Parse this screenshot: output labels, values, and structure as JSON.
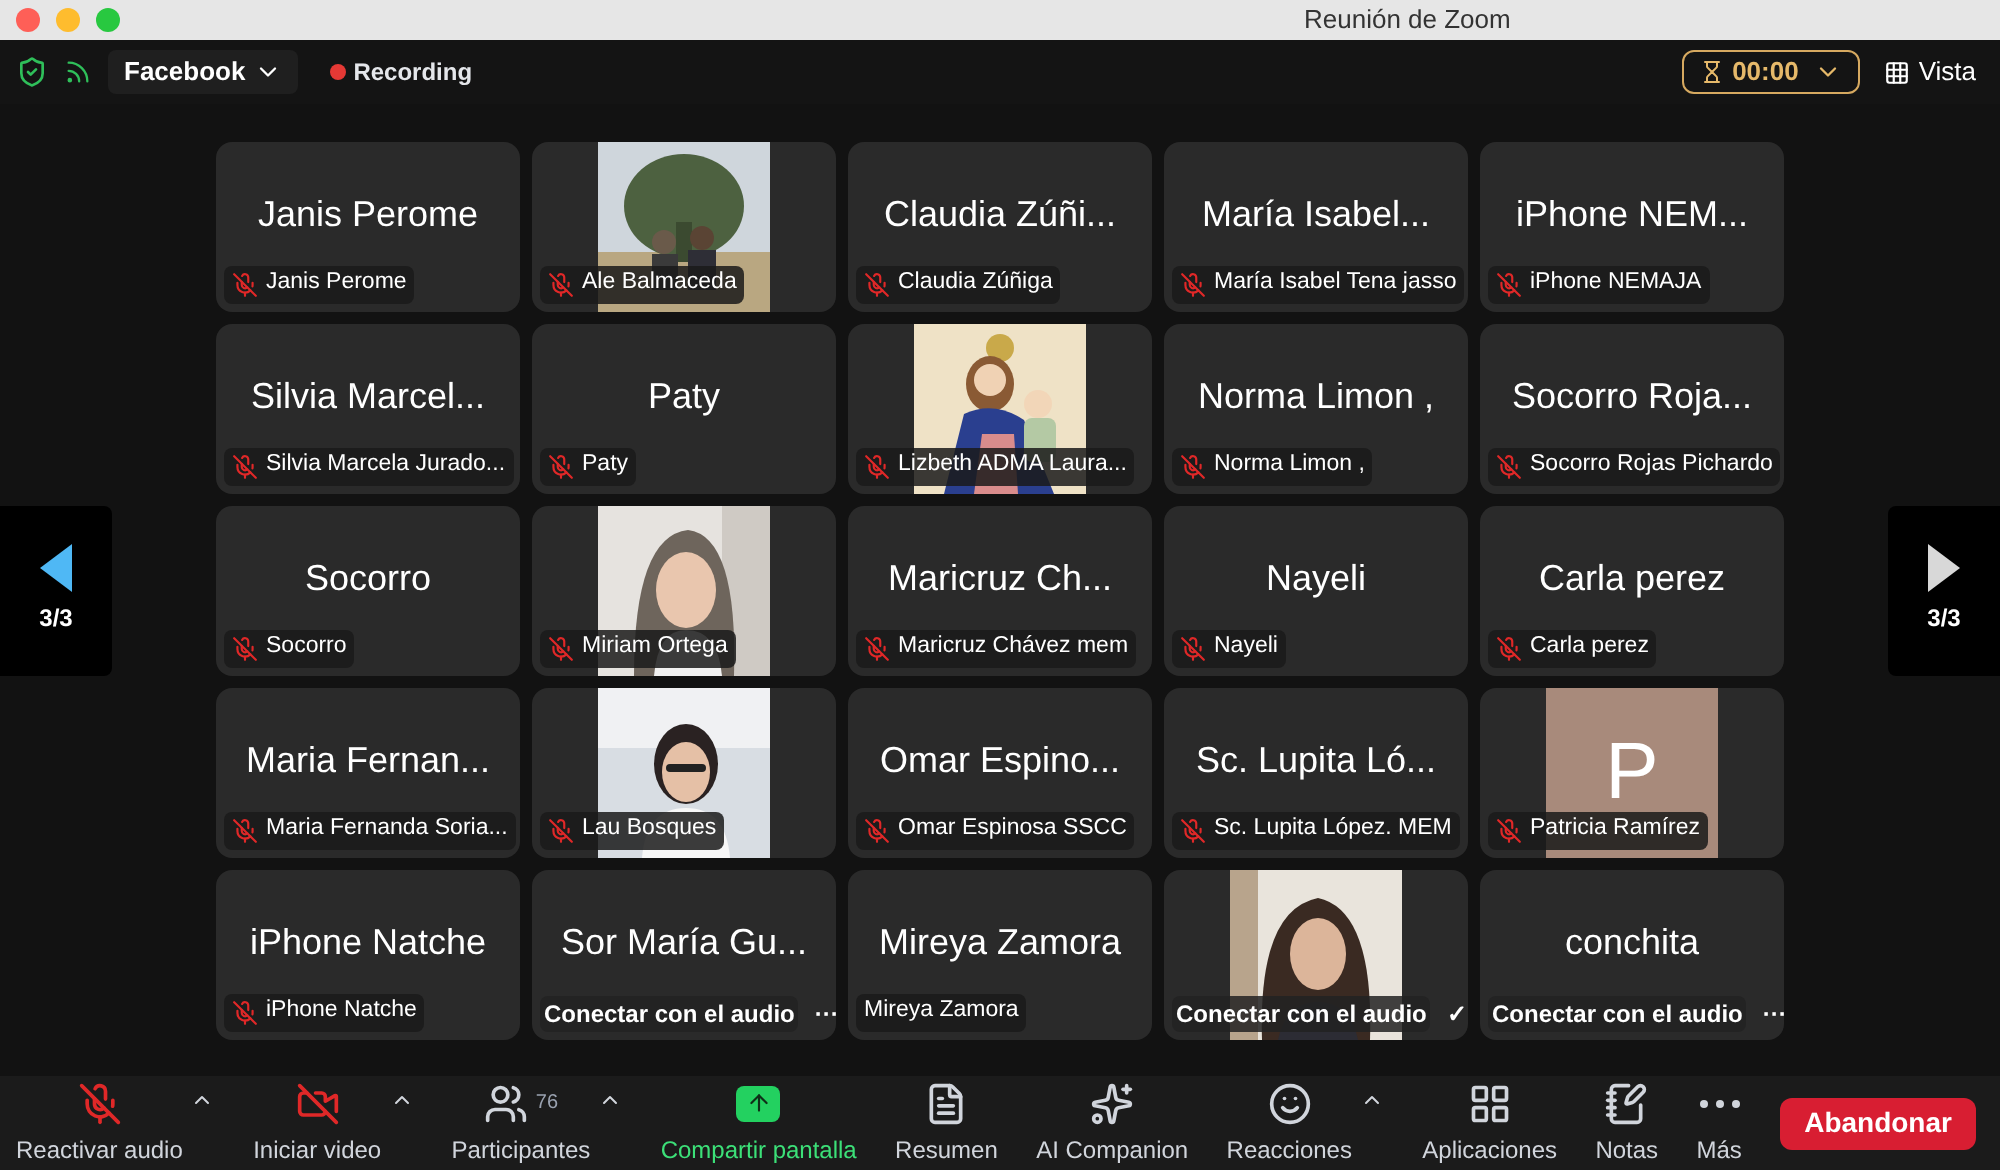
{
  "window": {
    "title": "Reunión de Zoom"
  },
  "top_bar": {
    "source": "Facebook",
    "recording": "Recording",
    "timer": "00:00",
    "view": "Vista"
  },
  "pager": {
    "left": "3/3",
    "right": "3/3"
  },
  "tiles": [
    {
      "kind": "name",
      "name": "Janis Perome",
      "label": {
        "kind": "name",
        "text": "Janis Perome",
        "muted": true
      }
    },
    {
      "kind": "picture",
      "label": {
        "kind": "name",
        "text": "Ale Balmaceda",
        "muted": true
      }
    },
    {
      "kind": "name",
      "name": "Claudia Zúñi...",
      "label": {
        "kind": "name",
        "text": "Claudia Zúñiga",
        "muted": true
      }
    },
    {
      "kind": "name",
      "name": "María Isabel...",
      "label": {
        "kind": "name",
        "text": "María Isabel Tena jasso",
        "muted": true
      }
    },
    {
      "kind": "name",
      "name": "iPhone NEM...",
      "label": {
        "kind": "name",
        "text": "iPhone NEMAJA",
        "muted": true
      }
    },
    {
      "kind": "name",
      "name": "Silvia Marcel...",
      "label": {
        "kind": "name",
        "text": "Silvia Marcela Jurado...",
        "muted": true
      }
    },
    {
      "kind": "name",
      "name": "Paty",
      "label": {
        "kind": "name",
        "text": "Paty",
        "muted": true
      }
    },
    {
      "kind": "picture",
      "label": {
        "kind": "name",
        "text": "Lizbeth ADMA Laura...",
        "muted": true
      }
    },
    {
      "kind": "name",
      "name": "Norma Limon ,",
      "label": {
        "kind": "name",
        "text": "Norma Limon ,",
        "muted": true
      }
    },
    {
      "kind": "name",
      "name": "Socorro Roja...",
      "label": {
        "kind": "name",
        "text": "Socorro Rojas Pichardo",
        "muted": true
      }
    },
    {
      "kind": "name",
      "name": "Socorro",
      "label": {
        "kind": "name",
        "text": "Socorro",
        "muted": true
      }
    },
    {
      "kind": "picture",
      "label": {
        "kind": "name",
        "text": "Miriam Ortega",
        "muted": true
      }
    },
    {
      "kind": "name",
      "name": "Maricruz Ch...",
      "label": {
        "kind": "name",
        "text": "Maricruz Chávez mem",
        "muted": true
      }
    },
    {
      "kind": "name",
      "name": "Nayeli",
      "label": {
        "kind": "name",
        "text": "Nayeli",
        "muted": true
      }
    },
    {
      "kind": "name",
      "name": "Carla perez",
      "label": {
        "kind": "name",
        "text": "Carla perez",
        "muted": true
      }
    },
    {
      "kind": "name",
      "name": "Maria Fernan...",
      "label": {
        "kind": "name",
        "text": "Maria Fernanda Soria...",
        "muted": true
      }
    },
    {
      "kind": "picture",
      "label": {
        "kind": "name",
        "text": "Lau Bosques",
        "muted": true
      }
    },
    {
      "kind": "name",
      "name": "Omar Espino...",
      "label": {
        "kind": "name",
        "text": "Omar Espinosa SSCC",
        "muted": true
      }
    },
    {
      "kind": "name",
      "name": "Sc. Lupita Ló...",
      "label": {
        "kind": "name",
        "text": "Sc. Lupita López. MEM",
        "muted": true
      }
    },
    {
      "kind": "letter",
      "letter": "P",
      "label": {
        "kind": "name",
        "text": "Patricia Ramírez",
        "muted": true
      }
    },
    {
      "kind": "name",
      "name": "iPhone Natche",
      "label": {
        "kind": "name",
        "text": "iPhone Natche",
        "muted": true
      }
    },
    {
      "kind": "name",
      "name": "Sor María Gu...",
      "label": {
        "kind": "audio",
        "text": "Conectar con el audio",
        "trailing": "···"
      }
    },
    {
      "kind": "name",
      "name": "Mireya Zamora",
      "label": {
        "kind": "name",
        "text": "Mireya Zamora",
        "muted": false
      }
    },
    {
      "kind": "picture",
      "label": {
        "kind": "audio",
        "text": "Conectar con el audio",
        "trailing": "✓"
      }
    },
    {
      "kind": "name",
      "name": "conchita",
      "label": {
        "kind": "audio",
        "text": "Conectar con el audio",
        "trailing": "···"
      }
    }
  ],
  "toolbar": [
    {
      "label": "Reactivar audio",
      "off": true,
      "caret": true
    },
    {
      "label": "Iniciar video",
      "off": true,
      "caret": true
    },
    {
      "label": "Participantes",
      "count": "76",
      "caret": true
    },
    {
      "label": "Compartir pantalla",
      "highlighted": true,
      "caret": false
    },
    {
      "label": "Resumen",
      "caret": false
    },
    {
      "label": "AI Companion",
      "caret": false
    },
    {
      "label": "Reacciones",
      "caret": true
    },
    {
      "label": "Aplicaciones",
      "caret": false
    },
    {
      "label": "Notas",
      "caret": false
    },
    {
      "label": "Más",
      "caret": false
    }
  ],
  "leave_button": "Abandonar"
}
